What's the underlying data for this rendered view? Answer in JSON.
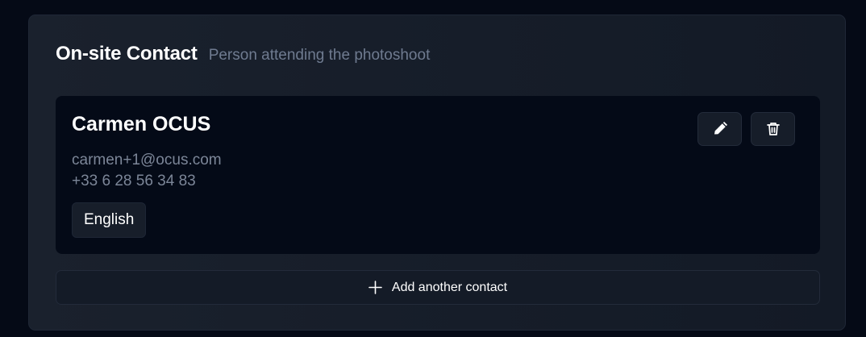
{
  "section": {
    "title": "On-site Contact",
    "subtitle": "Person attending the photoshoot"
  },
  "contact": {
    "name": "Carmen OCUS",
    "email": "carmen+1@ocus.com",
    "phone": "+33 6 28 56 34 83",
    "language": "English",
    "actions": {
      "edit_icon": "pencil-icon",
      "delete_icon": "trash-icon"
    }
  },
  "add_contact": {
    "label": "Add another contact",
    "icon": "plus-icon"
  },
  "colors": {
    "page_background": "#050a16",
    "panel_background": "#161d29",
    "card_background": "#040a17",
    "primary_text": "#ffffff",
    "secondary_text": "#7c8698"
  }
}
